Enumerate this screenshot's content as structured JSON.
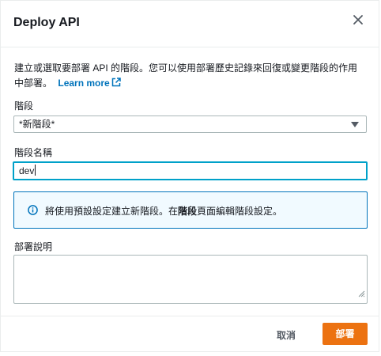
{
  "dialog": {
    "title": "Deploy API",
    "description_pre": "建立或選取要部署 API 的階段。您可以使用部署歷史記錄來回復或變更階段的作用中部署。",
    "learn_more": "Learn more"
  },
  "stage": {
    "label": "階段",
    "selected": "*新階段*"
  },
  "stage_name": {
    "label": "階段名稱",
    "value": "dev"
  },
  "info": {
    "text_pre": "將使用預設設定建立新階段。在",
    "text_bold": "階段",
    "text_post": "頁面編輯階段設定。"
  },
  "deployment_description": {
    "label": "部署說明",
    "value": ""
  },
  "footer": {
    "cancel_label": "取消",
    "deploy_label": "部署"
  },
  "colors": {
    "primary_button": "#ec7211",
    "link": "#0073bb",
    "focus_border": "#00a1c9",
    "info_border": "#0073bb",
    "info_bg": "#f1faff"
  }
}
